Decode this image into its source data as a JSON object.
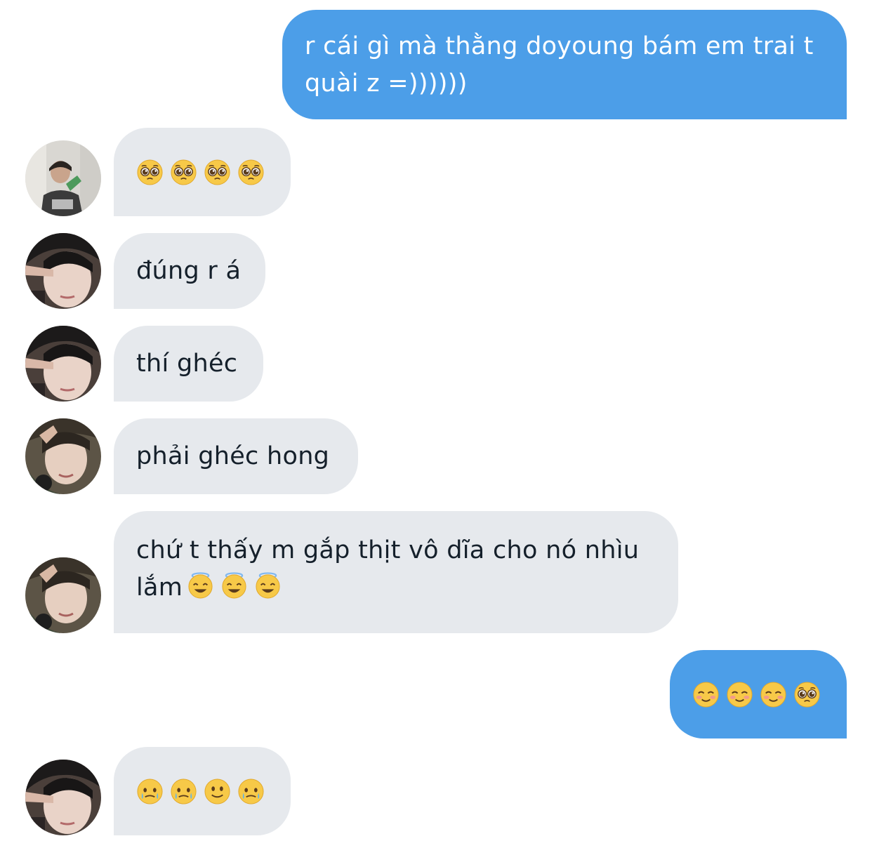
{
  "conversation": {
    "messages": [
      {
        "direction": "outgoing",
        "text": "r cái gì mà thằng doyoung bám em trai t quài z =))))))"
      },
      {
        "direction": "incoming",
        "avatar_icon": "profile-photo-1",
        "emojis": [
          "pleading-face-emoji",
          "pleading-face-emoji",
          "pleading-face-emoji",
          "pleading-face-emoji"
        ]
      },
      {
        "direction": "incoming",
        "avatar_icon": "profile-photo-2",
        "text": "đúng r á"
      },
      {
        "direction": "incoming",
        "avatar_icon": "profile-photo-2",
        "text": "thí ghéc"
      },
      {
        "direction": "incoming",
        "avatar_icon": "profile-photo-3",
        "text": "phải ghéc hong"
      },
      {
        "direction": "incoming",
        "avatar_icon": "profile-photo-3",
        "text": "chứ t thấy m gắp thịt vô dĩa cho nó nhìu lắm",
        "emojis": [
          "smiling-face-with-halo-emoji",
          "smiling-face-with-halo-emoji",
          "smiling-face-with-halo-emoji"
        ]
      },
      {
        "direction": "outgoing",
        "emojis": [
          "smiling-face-emoji",
          "smiling-face-emoji",
          "smiling-face-emoji",
          "pleading-face-emoji"
        ]
      },
      {
        "direction": "incoming",
        "avatar_icon": "profile-photo-2",
        "emojis": [
          "face-holding-back-tears-emoji",
          "face-holding-back-tears-emoji",
          "slightly-smiling-face-emoji",
          "face-holding-back-tears-emoji"
        ]
      }
    ]
  },
  "colors": {
    "outgoing_bubble": "#4c9ee8",
    "incoming_bubble": "#e6e9ed",
    "outgoing_text": "#ffffff",
    "incoming_text": "#15202b"
  }
}
